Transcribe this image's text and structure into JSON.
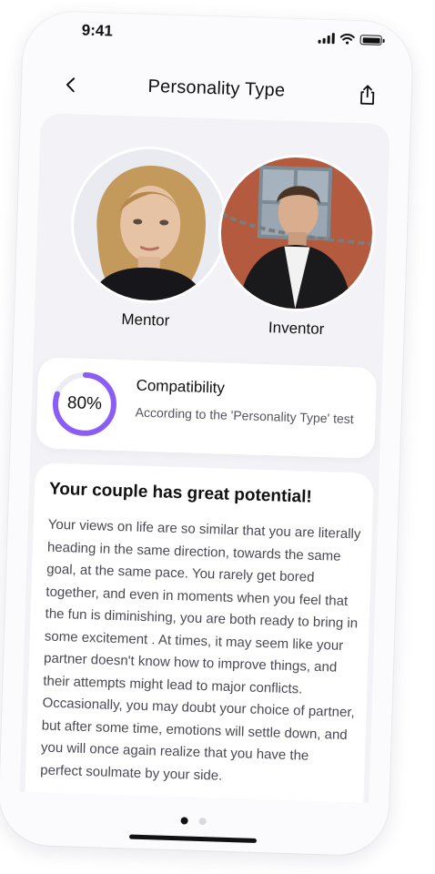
{
  "status_bar": {
    "time": "9:41"
  },
  "header": {
    "title": "Personality Type"
  },
  "icons": {
    "back": "chevron-left-icon",
    "share": "share-icon",
    "signal": "signal-icon",
    "wifi": "wifi-icon",
    "battery": "battery-icon"
  },
  "profiles": [
    {
      "label": "Mentor"
    },
    {
      "label": "Inventor"
    }
  ],
  "compatibility": {
    "percent_label": "80%",
    "value": 0.8,
    "title": "Compatibility",
    "description": "According to the 'Personality Type' test"
  },
  "potential": {
    "title": "Your couple has great potential!",
    "body": "Your views on life are so similar that you are literally heading in the same direction, towards the same goal, at the same pace. You rarely get bored together, and even in moments when you feel that the fun is diminishing, you are both ready to bring in some excitement . At times, it may seem like your partner doesn't know how to improve things, and their attempts might lead to major conflicts. Occasionally, you may doubt your choice of partner, but after some time, emotions will settle down, and you will once again realize that you have the perfect soulmate by your side."
  },
  "pager": {
    "count": 2,
    "active": 0
  },
  "colors": {
    "accent": "#8b5cf6",
    "track": "#ececf2",
    "background": "#f3f3f7",
    "card": "#ffffff"
  }
}
